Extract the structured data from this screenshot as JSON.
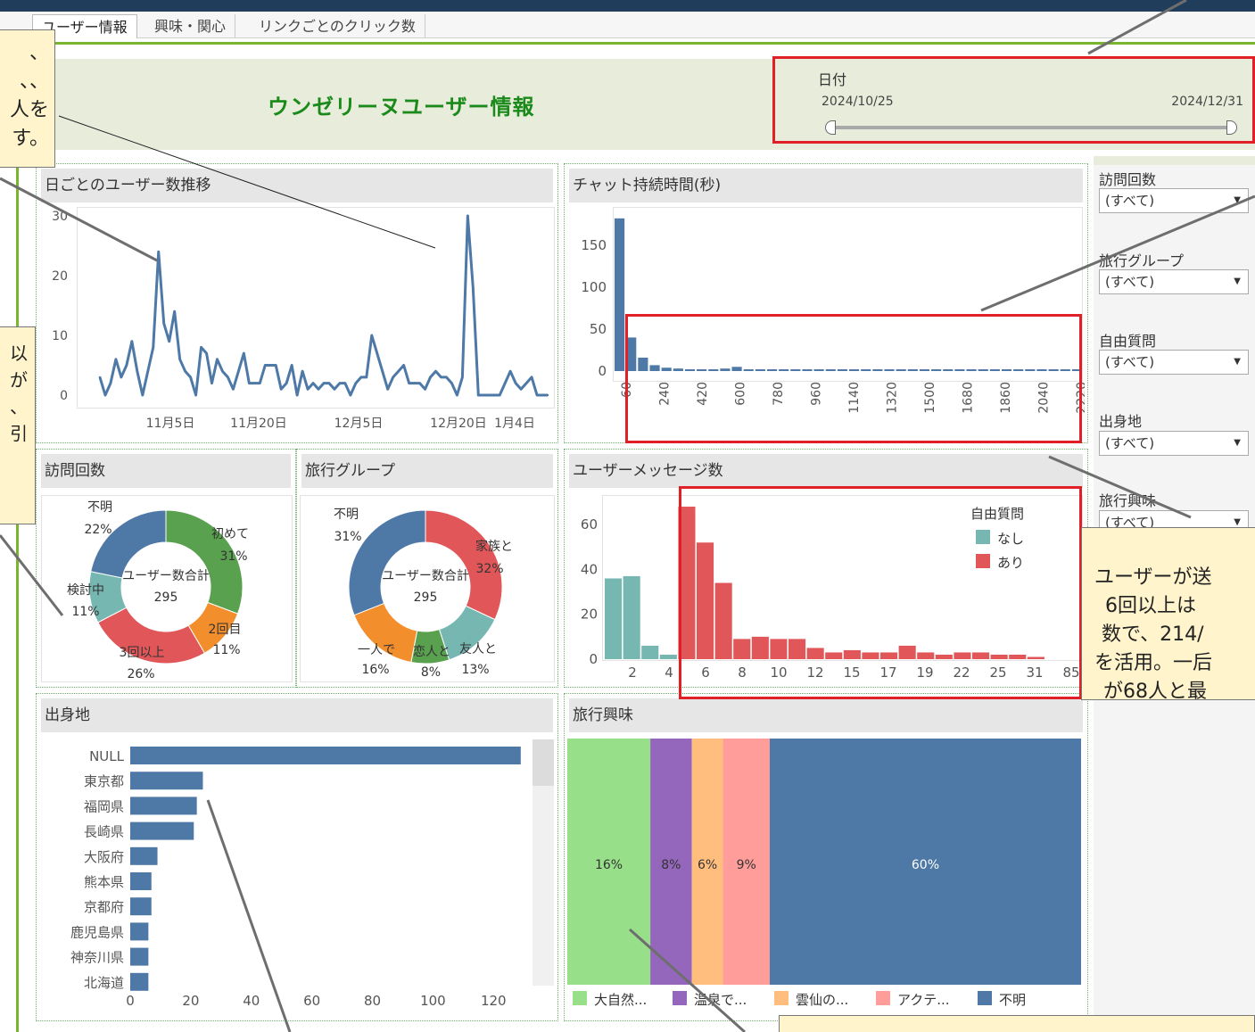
{
  "tabs": [
    {
      "label": "ユーザー情報"
    },
    {
      "label": "興味・関心"
    },
    {
      "label": "リンクごとのクリック数"
    }
  ],
  "header": {
    "title": "ウンゼリーヌユーザー情報"
  },
  "date_filter": {
    "label": "日付",
    "start": "2024/10/25",
    "end": "2024/12/31"
  },
  "filters": [
    {
      "label": "訪問回数",
      "value": "(すべて)"
    },
    {
      "label": "旅行グループ",
      "value": "(すべて)"
    },
    {
      "label": "自由質問",
      "value": "(すべて)"
    },
    {
      "label": "出身地",
      "value": "(すべて)"
    },
    {
      "label": "旅行興味",
      "value": "(すべて)"
    }
  ],
  "notes": {
    "top_left": [
      "、",
      "、、",
      "人を",
      "す。"
    ],
    "mid_left": [
      "以",
      "が",
      "",
      "、",
      "引"
    ],
    "right": [
      "ユーザーが送",
      "6回以上は",
      "数で、214/",
      "を活用。一后",
      "が68人と最"
    ],
    "bottom": ""
  },
  "panels": {
    "daily_users": {
      "title": "日ごとのユーザー数推移"
    },
    "chat_duration": {
      "title": "チャット持続時間(秒)"
    },
    "visit_count": {
      "title": "訪問回数",
      "center_label": "ユーザー数合計",
      "center_value": "295"
    },
    "travel_group": {
      "title": "旅行グループ",
      "center_label": "ユーザー数合計",
      "center_value": "295"
    },
    "user_messages": {
      "title": "ユーザーメッセージ数",
      "legend_title": "自由質問"
    },
    "origin": {
      "title": "出身地"
    },
    "travel_interest": {
      "title": "旅行興味"
    }
  },
  "colors": {
    "blue": "#4e79a7",
    "green": "#59a14f",
    "orange": "#f28e2b",
    "red": "#e15759",
    "teal": "#76b7b2",
    "purple": "#9467bd",
    "light_orange": "#ffbe7d",
    "pink": "#ff9d9a",
    "light_green": "#98df8a",
    "highlight_red": "#e01f26"
  },
  "chart_data": [
    {
      "id": "daily_users",
      "type": "line",
      "title": "日ごとのユーザー数推移",
      "x_tick_labels": [
        "11月5日",
        "11月20日",
        "12月5日",
        "12月20日",
        "1月4日"
      ],
      "y_ticks": [
        0,
        10,
        20,
        30
      ],
      "ylim": [
        0,
        30
      ],
      "x_start": "2024-10-25",
      "series": [
        {
          "values": [
            3,
            0,
            2,
            6,
            3,
            5,
            9,
            4,
            0,
            4,
            8,
            24,
            12,
            9,
            14,
            6,
            4,
            3,
            0,
            8,
            7,
            2,
            6,
            4,
            3,
            1,
            4,
            7,
            2,
            2,
            2,
            5,
            5,
            5,
            1,
            2,
            5,
            0,
            4,
            1,
            2,
            1,
            2,
            2,
            1,
            2,
            2,
            0,
            2,
            3,
            3,
            10,
            7,
            4,
            1,
            3,
            4,
            5,
            2,
            2,
            2,
            1,
            3,
            4,
            3,
            3,
            2,
            0,
            3,
            30,
            18,
            0,
            0,
            0,
            0,
            0,
            2,
            4,
            2,
            1,
            2,
            3,
            0,
            0,
            0
          ]
        }
      ]
    },
    {
      "id": "chat_duration",
      "type": "bar",
      "title": "チャット持続時間(秒)",
      "x_tick_labels": [
        "60",
        "240",
        "420",
        "600",
        "780",
        "960",
        "1140",
        "1320",
        "1500",
        "1680",
        "1860",
        "2040",
        "2220"
      ],
      "y_ticks": [
        0,
        50,
        100,
        150
      ],
      "ylim": [
        0,
        185
      ],
      "bin_width_seconds": 60,
      "values": [
        182,
        40,
        16,
        7,
        4,
        3,
        2,
        2,
        2,
        3,
        5,
        2,
        2,
        1,
        1,
        1,
        1,
        1,
        1,
        1,
        1,
        1,
        1,
        1,
        1,
        1,
        1,
        1,
        1,
        1,
        1,
        1,
        1,
        1,
        1,
        1,
        1,
        1,
        1,
        1
      ]
    },
    {
      "id": "visit_count",
      "type": "pie",
      "title": "訪問回数",
      "slices": [
        {
          "label": "初めて",
          "pct": "31%",
          "value": 31,
          "color": "#59a14f"
        },
        {
          "label": "2回目",
          "pct": "11%",
          "value": 11,
          "color": "#f28e2b"
        },
        {
          "label": "3回以上",
          "pct": "26%",
          "value": 26,
          "color": "#e15759"
        },
        {
          "label": "検討中",
          "pct": "11%",
          "value": 11,
          "color": "#76b7b2"
        },
        {
          "label": "不明",
          "pct": "22%",
          "value": 22,
          "color": "#4e79a7"
        }
      ]
    },
    {
      "id": "travel_group",
      "type": "pie",
      "title": "旅行グループ",
      "slices": [
        {
          "label": "家族と",
          "pct": "32%",
          "value": 32,
          "color": "#e15759"
        },
        {
          "label": "友人と",
          "pct": "13%",
          "value": 13,
          "color": "#76b7b2"
        },
        {
          "label": "恋人と",
          "pct": "8%",
          "value": 8,
          "color": "#59a14f"
        },
        {
          "label": "一人で",
          "pct": "16%",
          "value": 16,
          "color": "#f28e2b"
        },
        {
          "label": "不明",
          "pct": "31%",
          "value": 31,
          "color": "#4e79a7"
        }
      ]
    },
    {
      "id": "user_messages",
      "type": "bar",
      "title": "ユーザーメッセージ数",
      "legend": [
        {
          "name": "なし",
          "color": "#76b7b2"
        },
        {
          "name": "あり",
          "color": "#e15759"
        }
      ],
      "legend_title": "自由質問",
      "x_tick_labels": [
        "2",
        "4",
        "6",
        "8",
        "10",
        "12",
        "15",
        "17",
        "19",
        "22",
        "25",
        "31",
        "85"
      ],
      "y_ticks": [
        0,
        20,
        40,
        60
      ],
      "ylim": [
        0,
        70
      ],
      "series": [
        {
          "name": "なし",
          "values": [
            36,
            37,
            6,
            2
          ]
        },
        {
          "name": "あり",
          "values": [
            68,
            52,
            34,
            9,
            10,
            9,
            9,
            5,
            3,
            4,
            3,
            3,
            6,
            3,
            2,
            3,
            3,
            2,
            2,
            1
          ]
        }
      ]
    },
    {
      "id": "origin",
      "type": "bar",
      "orientation": "horizontal",
      "title": "出身地",
      "categories": [
        "NULL",
        "東京都",
        "福岡県",
        "長崎県",
        "大阪府",
        "熊本県",
        "京都府",
        "鹿児島県",
        "神奈川県",
        "北海道"
      ],
      "values": [
        129,
        24,
        22,
        21,
        9,
        7,
        7,
        6,
        6,
        6
      ],
      "x_ticks": [
        0,
        20,
        40,
        60,
        80,
        100,
        120
      ],
      "xlim": [
        0,
        132
      ]
    },
    {
      "id": "travel_interest",
      "type": "bar",
      "subtype": "100%-stacked",
      "title": "旅行興味",
      "segments": [
        {
          "label": "大自然...",
          "pct": "16%",
          "value": 16,
          "color": "#98df8a"
        },
        {
          "label": "温泉で...",
          "pct": "8%",
          "value": 8,
          "color": "#9467bd"
        },
        {
          "label": "雲仙の...",
          "pct": "6%",
          "value": 6,
          "color": "#ffbe7d"
        },
        {
          "label": "アクテ...",
          "pct": "9%",
          "value": 9,
          "color": "#ff9d9a"
        },
        {
          "label": "不明",
          "pct": "60%",
          "value": 60,
          "color": "#4e79a7"
        }
      ]
    }
  ]
}
